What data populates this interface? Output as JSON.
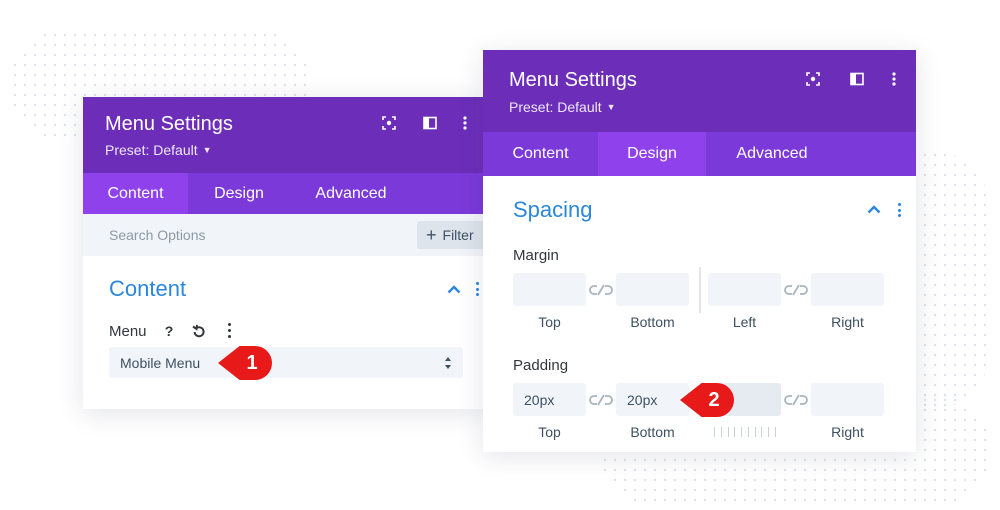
{
  "panel1": {
    "title": "Menu Settings",
    "preset": "Preset: Default",
    "icons": [
      "target-icon",
      "columns-icon",
      "more-vertical-icon"
    ],
    "tabs": [
      {
        "label": "Content",
        "active": true
      },
      {
        "label": "Design",
        "active": false
      },
      {
        "label": "Advanced",
        "active": false
      }
    ],
    "search": {
      "placeholder": "Search Options",
      "value": ""
    },
    "filter_label": "Filter",
    "section_title": "Content",
    "field": {
      "label": "Menu",
      "icons": [
        "help-icon",
        "reset-icon",
        "more-vertical-icon"
      ],
      "value": "Mobile Menu"
    },
    "marker": "1"
  },
  "panel2": {
    "title": "Menu Settings",
    "preset": "Preset: Default",
    "icons": [
      "target-icon",
      "columns-icon",
      "more-vertical-icon"
    ],
    "tabs": [
      {
        "label": "Content",
        "active": false
      },
      {
        "label": "Design",
        "active": true
      },
      {
        "label": "Advanced",
        "active": false
      }
    ],
    "section_title": "Spacing",
    "margin": {
      "label": "Margin",
      "fields": [
        {
          "label": "Top",
          "value": ""
        },
        {
          "label": "Bottom",
          "value": ""
        },
        {
          "label": "Left",
          "value": ""
        },
        {
          "label": "Right",
          "value": ""
        }
      ]
    },
    "padding": {
      "label": "Padding",
      "fields": [
        {
          "label": "Top",
          "value": "20px"
        },
        {
          "label": "Bottom",
          "value": "20px"
        },
        {
          "label": "",
          "value": ""
        },
        {
          "label": "Right",
          "value": ""
        }
      ]
    },
    "marker": "2"
  },
  "colors": {
    "header": "#6c2eb9",
    "tabs": "#7b39da",
    "active_tab": "#8f42ec",
    "accent": "#2b87da",
    "marker": "#e81919"
  }
}
